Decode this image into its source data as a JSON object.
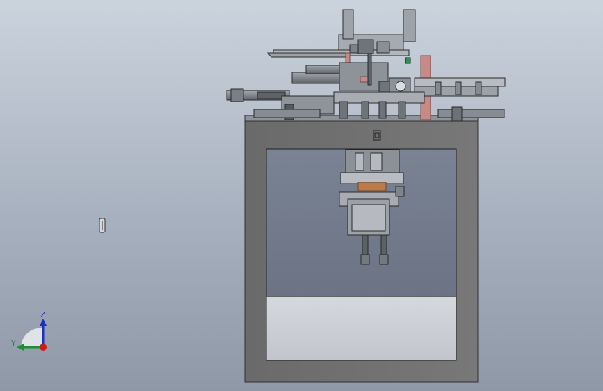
{
  "viewport": {
    "background_top": "#cbd3dd",
    "background_bottom": "#8f98a6"
  },
  "model": {
    "frame_color": "#6f6f6f",
    "upper_panel_color": "#737b8b",
    "lower_panel_color": "#c9cdd3",
    "accent_red": "#c98a86",
    "accent_green": "#2f8f4f",
    "accent_copper": "#b97a4e"
  },
  "triad": {
    "z_label": "Z",
    "y_label": "Y",
    "z_color": "#1d2fbf",
    "y_color": "#1c8f2e",
    "x_color": "#c61d1d"
  },
  "cursor_icon": "pointer-cursor-icon"
}
